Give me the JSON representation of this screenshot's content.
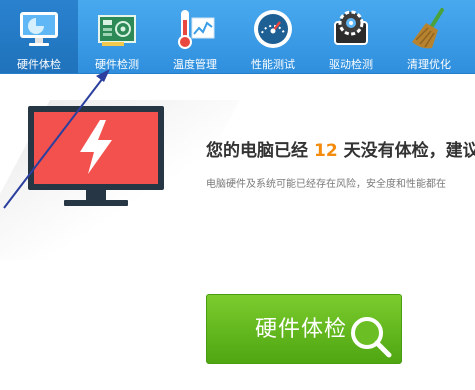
{
  "topbar": {
    "tabs": [
      {
        "label": "硬件体检",
        "icon": "monitor-check-icon"
      },
      {
        "label": "硬件检测",
        "icon": "circuit-board-icon"
      },
      {
        "label": "温度管理",
        "icon": "thermometer-chart-icon"
      },
      {
        "label": "性能测试",
        "icon": "speedometer-icon"
      },
      {
        "label": "驱动检测",
        "icon": "gear-chip-icon"
      },
      {
        "label": "清理优化",
        "icon": "broom-icon"
      }
    ],
    "active_index": 0
  },
  "main": {
    "heading_prefix": "您的电脑已经",
    "days": "12",
    "heading_suffix": "天没有体检，建议",
    "subtext": "电脑硬件及系统可能已经存在风险，安全度和性能都在",
    "check_button_label": "硬件体检"
  },
  "colors": {
    "topbar": "#3a9de8",
    "accent_days": "#f48b0c",
    "button_green": "#5fb51c",
    "screen_red": "#f2514e",
    "annotation_line": "#2b3f9e"
  }
}
